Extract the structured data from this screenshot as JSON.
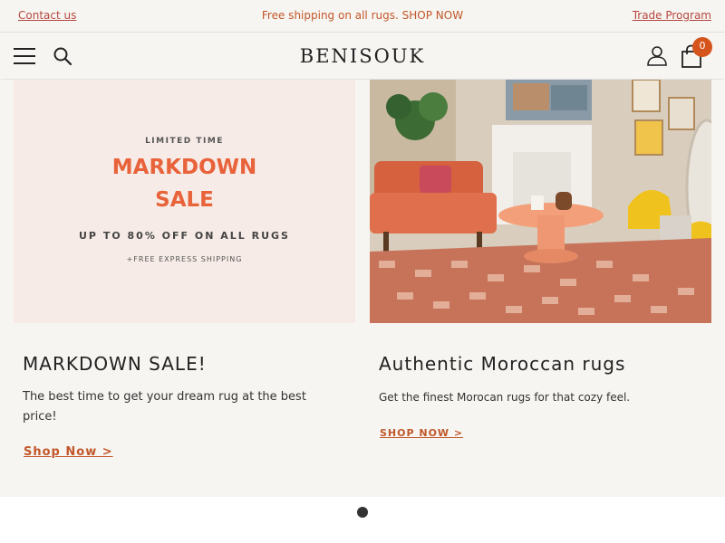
{
  "announcement": {
    "contact": "Contact us",
    "message": "Free shipping on all rugs.",
    "shop_now": "SHOP NOW",
    "trade": "Trade Program"
  },
  "header": {
    "logo": "BENISOUK",
    "cart_count": "0"
  },
  "colors": {
    "accent": "#c1572b",
    "badge": "#d4541c",
    "background": "#f7f5f1"
  },
  "slides": [
    {
      "image": {
        "limited": "LIMITED TIME",
        "line1": "MARKDOWN",
        "line2": "SALE",
        "offer": "UP TO 80% OFF ON ALL RUGS",
        "shipping": "+FREE EXPRESS SHIPPING"
      },
      "title": "MARKDOWN SALE!",
      "description": "The best time to get your dream rug at the best price!",
      "link": "Shop Now >"
    },
    {
      "title": "Authentic Moroccan rugs",
      "description": "Get the finest Morocan rugs for that cozy feel.",
      "link": "SHOP NOW >"
    }
  ],
  "icons": [
    "menu-icon",
    "search-icon",
    "user-icon",
    "cart-icon"
  ]
}
